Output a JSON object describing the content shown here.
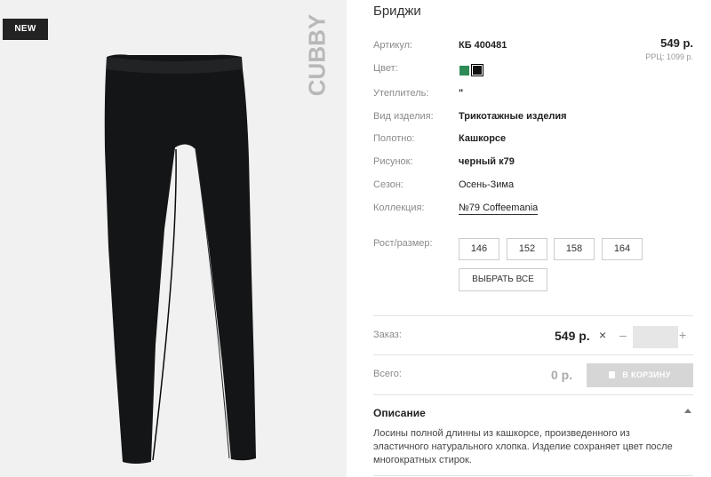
{
  "product": {
    "badge": "NEW",
    "brand": "CUBBY",
    "title": "Бриджи"
  },
  "price": {
    "main": "549 р.",
    "rrp": "РРЦ: 1099 р."
  },
  "colors": {
    "selected": "#000000",
    "options": [
      "#2e8b57",
      "#000000"
    ]
  },
  "attributes": [
    {
      "label": "Артикул:",
      "value": "КБ 400481"
    },
    {
      "label": "Цвет:",
      "value": ""
    },
    {
      "label": "Утеплитель:",
      "value": "\""
    },
    {
      "label": "Вид изделия:",
      "value": "Трикотажные изделия"
    },
    {
      "label": "Полотно:",
      "value": "Кашкорсе"
    },
    {
      "label": "Рисунок:",
      "value": "черный к79"
    },
    {
      "label": "Сезон:",
      "value": "Осень-Зима"
    },
    {
      "label": "Коллекция:",
      "value": "№79 Coffeemania"
    }
  ],
  "sizes": {
    "label": "Рост/размер:",
    "options": [
      "146",
      "152",
      "158",
      "164"
    ],
    "select_all": "ВЫБРАТЬ ВСЕ"
  },
  "order": {
    "label": "Заказ:",
    "price": "549 р.",
    "times": "×",
    "minus": "–",
    "plus": "+",
    "quantity": ""
  },
  "total": {
    "label": "Всего:",
    "value": "0 р.",
    "cart_button": "В КОРЗИНУ"
  },
  "description": {
    "title": "Описание",
    "text": "Лосины полной длинны из кашкорсе, произведенного из эластичного натурального хлопка. Изделие сохраняет цвет после многократных стирок."
  }
}
